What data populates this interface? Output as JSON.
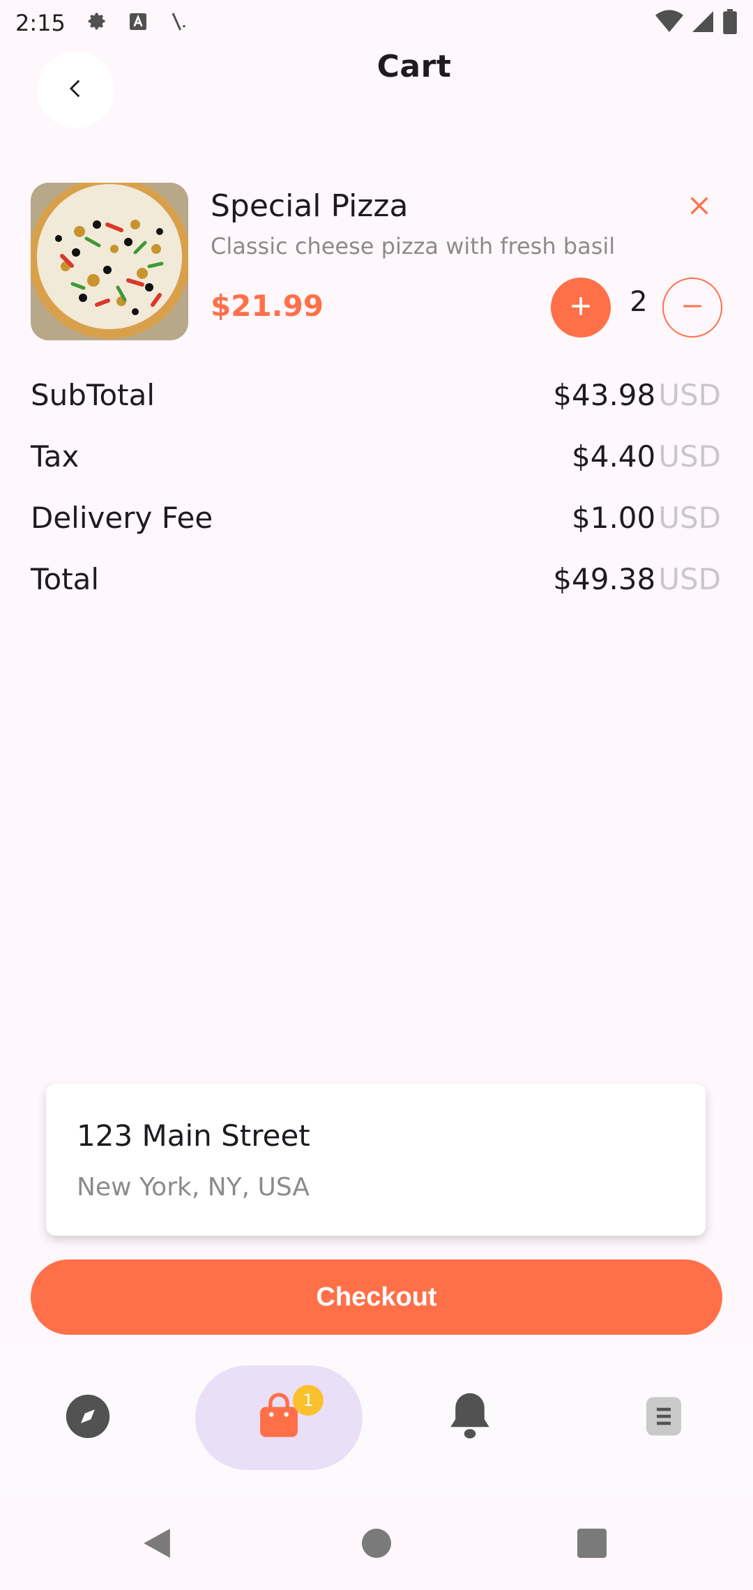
{
  "status_bar": {
    "time": "2:15",
    "icons": [
      "settings-icon",
      "font-a-icon",
      "slash-icon",
      "wifi-icon",
      "signal-icon",
      "battery-icon"
    ]
  },
  "header": {
    "title": "Cart",
    "back_icon": "chevron-left-icon"
  },
  "cart_item": {
    "name": "Special Pizza",
    "description": "Classic cheese pizza with fresh basil",
    "price": "$21.99",
    "quantity": "2",
    "remove_icon": "close-icon",
    "plus_icon": "plus-icon",
    "minus_icon": "minus-icon",
    "image": "pizza-image"
  },
  "summary": {
    "rows": [
      {
        "label": "SubTotal",
        "amount": "$43.98",
        "currency": "USD"
      },
      {
        "label": "Tax",
        "amount": "$4.40",
        "currency": "USD"
      },
      {
        "label": "Delivery Fee",
        "amount": "$1.00",
        "currency": "USD"
      },
      {
        "label": "Total",
        "amount": "$49.38",
        "currency": "USD"
      }
    ]
  },
  "address": {
    "line1": "123 Main Street",
    "line2": "New York, NY, USA"
  },
  "checkout": {
    "label": "Checkout"
  },
  "bottom_nav": {
    "items": [
      {
        "icon": "compass-icon",
        "active": false
      },
      {
        "icon": "shopping-bag-icon",
        "active": true,
        "badge": "1"
      },
      {
        "icon": "bell-icon",
        "active": false
      },
      {
        "icon": "orders-icon",
        "active": false
      }
    ]
  },
  "colors": {
    "accent": "#ff7049",
    "background": "#fef7fb",
    "nav_active": "#e9dff7",
    "badge": "#fbc02d",
    "muted_text": "#8b8b8b",
    "currency_text": "#c9c6cc"
  },
  "system_nav": [
    "back-triangle-icon",
    "home-circle-icon",
    "recents-square-icon"
  ]
}
